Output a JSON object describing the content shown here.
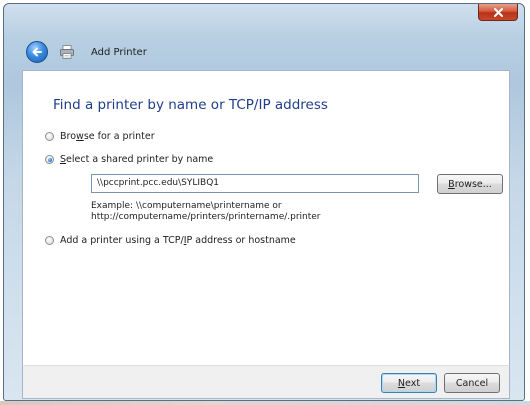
{
  "window": {
    "close_label": "X"
  },
  "header": {
    "title": "Add Printer"
  },
  "page": {
    "title": "Find a printer by name or TCP/IP address"
  },
  "options": {
    "browse": {
      "accel": "Bro",
      "key": "w",
      "rest": "se for a printer",
      "selected": false
    },
    "shared": {
      "key": "S",
      "rest": "elect a shared printer by name",
      "selected": true
    },
    "tcpip": {
      "before": "Add a printer using a TCP/",
      "key": "I",
      "after": "P address or hostname",
      "selected": false
    }
  },
  "shared_printer": {
    "value": "\\\\pccprint.pcc.edu\\SYLIBQ1",
    "browse_key": "B",
    "browse_rest": "rowse...",
    "example_line1": "Example: \\\\computername\\printername or",
    "example_line2": "http://computername/printers/printername/.printer"
  },
  "footer": {
    "next_key": "N",
    "next_rest": "ext",
    "cancel_label": "Cancel"
  }
}
